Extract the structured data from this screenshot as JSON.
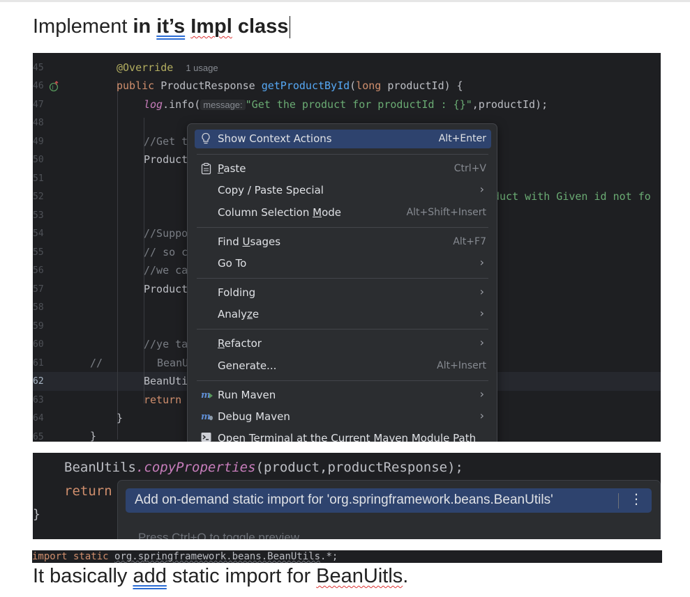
{
  "heading": {
    "plain": "Implement ",
    "bold_in": "in ",
    "bold_its": "it’s",
    "bold_impl": "Impl",
    "bold_class": " class"
  },
  "editor": {
    "line_numbers": [
      "45",
      "46",
      "47",
      "48",
      "49",
      "50",
      "51",
      "52",
      "53",
      "54",
      "55",
      "56",
      "57",
      "58",
      "59",
      "60",
      "61",
      "62",
      "63",
      "64",
      "65"
    ],
    "active_line": "62",
    "override_annotation": "@Override",
    "usage_hint": "1 usage",
    "kw_public": "public",
    "return_type": "ProductResponse",
    "method_name": "getProductById",
    "paren_open": "(",
    "kw_long": "long",
    "param": "productId) {",
    "log_obj": "log",
    "log_call": ".info(",
    "message_hint": "message:",
    "log_string": "\"Get the product for productId : {}\"",
    "log_rest": ",productId);",
    "comment_get": "//Get t",
    "product_1": "Product",
    "exception_msg": "duct with Given id not fo",
    "comment_supp": "//Suppo",
    "comment_so": "// so c",
    "comment_we": "//we ca",
    "product_2": "Product",
    "comment_ye": "//ye ta",
    "comment_slashes": "//",
    "bean_comment": "BeanU",
    "bean_active": "BeanUti",
    "kw_return": "return",
    "brace_close": "}",
    "brace_close2": "}"
  },
  "context_menu": {
    "items": [
      {
        "label": "Show Context Actions",
        "shortcut": "Alt+Enter",
        "icon": "lightbulb-icon"
      },
      {
        "label_pre": "",
        "label_u": "P",
        "label_post": "aste",
        "shortcut": "Ctrl+V",
        "icon": "clipboard-icon"
      },
      {
        "label": "Copy / Paste Special",
        "submenu": "›"
      },
      {
        "label_pre": "Column Selection ",
        "label_u": "M",
        "label_post": "ode",
        "shortcut": "Alt+Shift+Insert"
      },
      {
        "label_pre": "Find ",
        "label_u": "U",
        "label_post": "sages",
        "shortcut": "Alt+F7"
      },
      {
        "label": "Go To",
        "submenu": "›"
      },
      {
        "label": "Folding",
        "submenu": "›"
      },
      {
        "label_pre": "Analy",
        "label_u": "z",
        "label_post": "e",
        "submenu": "›"
      },
      {
        "label_pre": "",
        "label_u": "R",
        "label_post": "efactor",
        "submenu": "›"
      },
      {
        "label": "Generate...",
        "shortcut": "Alt+Insert"
      },
      {
        "label": "Run Maven",
        "submenu": "›",
        "icon": "maven-run-icon"
      },
      {
        "label": "Debug Maven",
        "submenu": "›",
        "icon": "maven-debug-icon"
      },
      {
        "label": "Open Terminal at the Current Maven Module Path",
        "icon": "terminal-icon"
      }
    ]
  },
  "editor2": {
    "bean_utils": "BeanUtils",
    "copy_props": ".copyProperties",
    "args": "(product,productResponse);",
    "kw_return": "return",
    "margin_mark": "}",
    "quick_fix": "Add on-demand static import for 'org.springframework.beans.BeanUtils'",
    "more_glyph": "⋮",
    "press_hint": "Press Ctrl+Q to toggle preview"
  },
  "import_line": {
    "kw_import": "import",
    "kw_static": " static ",
    "package": "org.springframework.beans.BeanUtils",
    "suffix": ".*;"
  },
  "bottom_text": {
    "pre": "It basically ",
    "add": "add",
    "mid": " static import for ",
    "beanuitls": "BeanUitls",
    "post": "."
  }
}
